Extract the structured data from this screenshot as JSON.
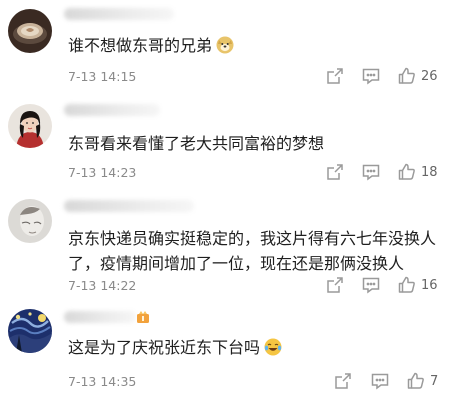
{
  "comments": [
    {
      "text": "谁不想做东哥的兄弟",
      "emoji": "doge-emoji",
      "time": "7-13 14:15",
      "likes": "26",
      "avatar": "coffee-cup-avatar"
    },
    {
      "text": "东哥看来看懂了老大共同富裕的梦想",
      "time": "7-13 14:23",
      "likes": "18",
      "avatar": "woman-portrait-avatar"
    },
    {
      "text": "京东快递员确实挺稳定的，我这片得有六七年没换人了，疫情期间增加了一位，现在还是那俩没换人",
      "time": "7-13 14:22",
      "likes": "16",
      "avatar": "sketch-portrait-avatar"
    },
    {
      "text": "这是为了庆祝张近东下台吗",
      "emoji": "laughing-tears-emoji",
      "time": "7-13 14:35",
      "likes": "7",
      "avatar": "starry-night-avatar"
    }
  ],
  "icons": {
    "share": "share-icon",
    "reply": "comment-icon",
    "like": "thumbs-up-icon"
  },
  "colors": {
    "text": "#1f1f1f",
    "meta": "#8a8a8a",
    "icon": "#9a9a9a"
  }
}
